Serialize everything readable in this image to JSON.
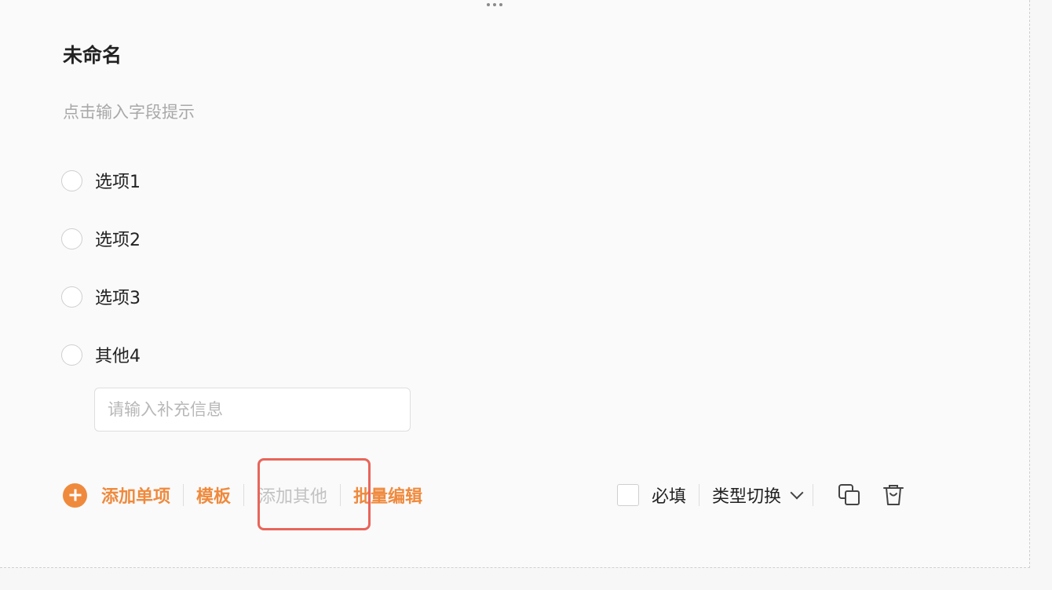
{
  "question": {
    "title": "未命名",
    "hint": "点击输入字段提示",
    "options": [
      {
        "label": "选项1"
      },
      {
        "label": "选项2"
      },
      {
        "label": "选项3"
      },
      {
        "label": "其他4"
      }
    ],
    "extra_input": {
      "placeholder": "请输入补充信息",
      "value": ""
    }
  },
  "toolbar": {
    "add_single": "添加单项",
    "template": "模板",
    "add_other": "添加其他",
    "batch_edit": "批量编辑"
  },
  "settings": {
    "required_label": "必填",
    "type_switch_label": "类型切换"
  },
  "icons": {
    "add": "plus-circle-icon",
    "copy": "copy-icon",
    "delete": "trash-icon",
    "dropdown": "chevron-down-icon",
    "drag": "drag-handle-icon"
  },
  "colors": {
    "accent": "#ef8a3d",
    "highlight": "#e8655a",
    "disabled": "#c2c2c2"
  }
}
